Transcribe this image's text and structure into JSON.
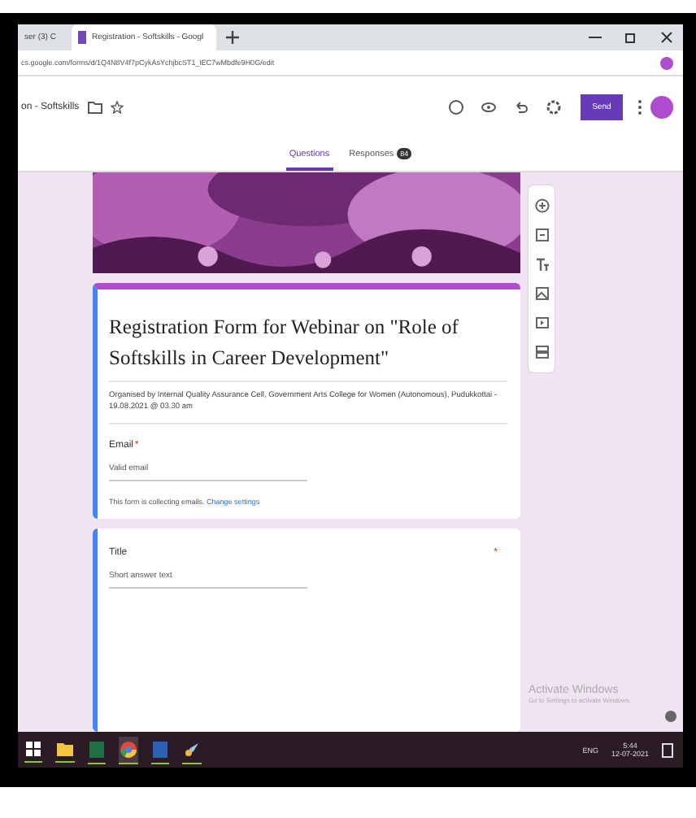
{
  "browser": {
    "tabs": [
      {
        "label": "ser (3) C",
        "selected": false
      },
      {
        "label": "Registration - Softskills - Googl",
        "selected": true
      }
    ],
    "url": "cs.google.com/forms/d/1Q4N8V4f7pCykAsYchjbcST1_lEC7wMbdfe9H0G/edit"
  },
  "forms_header": {
    "doc_title": "on - Softskills",
    "send": "Send"
  },
  "form_tabs": [
    {
      "label": "Questions",
      "selected": true
    },
    {
      "label": "Responses",
      "selected": false,
      "badge": "84"
    }
  ],
  "form": {
    "title": "Registration Form for Webinar on \"Role of Softskills in Career Development\"",
    "description": "Organised by Internal Quality Assurance Cell, Government Arts College for Women (Autonomous), Pudukkottai - 19.08.2021 @ 03.30 am",
    "email_label": "Email",
    "email_required_mark": "*",
    "email_placeholder": "Valid email",
    "note": "This form is collecting emails.",
    "note_link": "Change settings"
  },
  "question": {
    "title": "Title",
    "required_mark": "*",
    "placeholder": "Short answer text"
  },
  "watermark": {
    "title": "Activate Windows",
    "subtitle": "Go to Settings to activate Windows."
  },
  "taskbar": {
    "lang": "ENG",
    "time": "5:44",
    "date": "12-07-2021"
  }
}
